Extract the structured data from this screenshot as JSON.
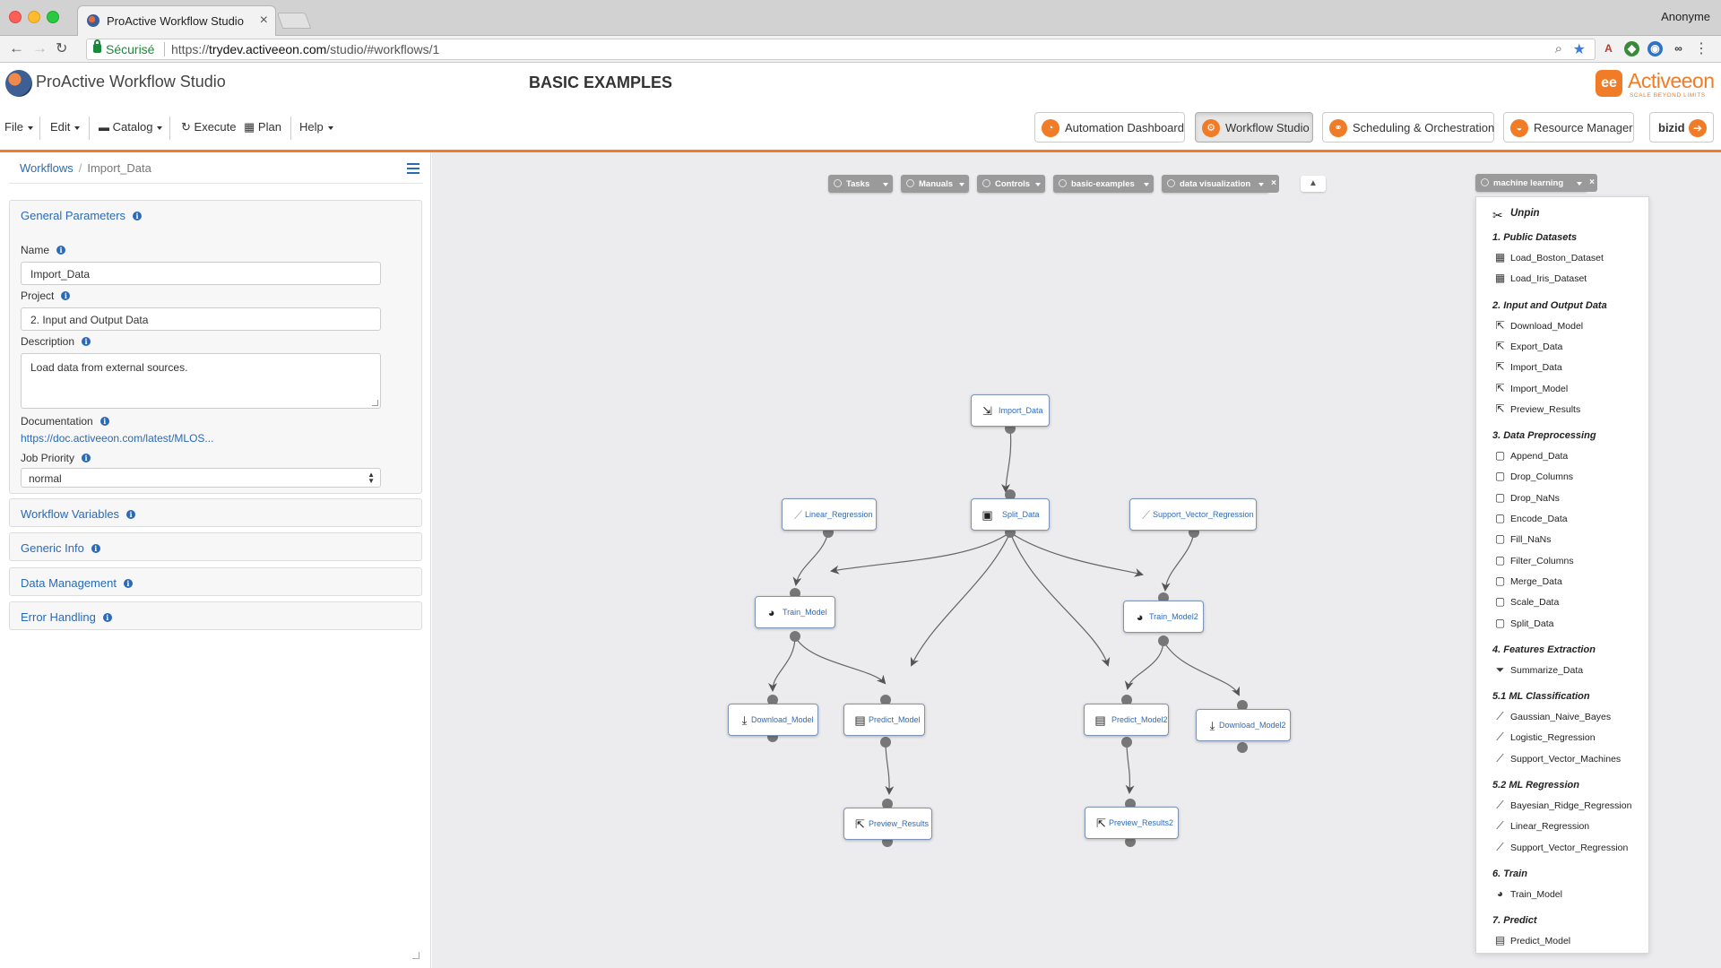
{
  "browser": {
    "tab_title": "ProActive Workflow Studio",
    "profile": "Anonyme",
    "secure_label": "Sécurisé",
    "url_scheme": "https://",
    "url_host": "trydev.activeeon.com",
    "url_path": "/studio/#workflows/1"
  },
  "app": {
    "title": "ProActive Workflow Studio",
    "page_heading": "BASIC EXAMPLES",
    "brand_name": "Activeeon",
    "brand_tagline": "SCALE BEYOND LIMITS",
    "menu": {
      "file": "File",
      "edit": "Edit",
      "catalog": "Catalog",
      "execute": "Execute",
      "plan": "Plan",
      "help": "Help"
    },
    "portals": [
      "Automation Dashboard",
      "Workflow Studio",
      "Scheduling & Orchestration",
      "Resource Manager"
    ],
    "user": "bizid"
  },
  "breadcrumb": {
    "root": "Workflows",
    "current": "Import_Data"
  },
  "general": {
    "title": "General Parameters",
    "name_label": "Name",
    "name_value": "Import_Data",
    "project_label": "Project",
    "project_value": "2. Input and Output Data",
    "description_label": "Description",
    "description_value": "Load data from external sources.",
    "documentation_label": "Documentation",
    "documentation_value": "https://doc.activeeon.com/latest/MLOS...",
    "priority_label": "Job Priority",
    "priority_value": "normal"
  },
  "panels": [
    "Workflow Variables",
    "Generic Info",
    "Data Management",
    "Error Handling"
  ],
  "toolbar": [
    "Tasks",
    "Manuals",
    "Controls",
    "basic-examples",
    "data visualization"
  ],
  "tasks": {
    "import_data": "Import_Data",
    "linear_regression": "Linear_Regression",
    "split_data": "Split_Data",
    "support_vector_regression": "Support_Vector_Regression",
    "train_model": "Train_Model",
    "train_model2": "Train_Model2",
    "download_model": "Download_Model",
    "predict_model": "Predict_Model",
    "predict_model2": "Predict_Model2",
    "download_model2": "Download_Model2",
    "preview_results": "Preview_Results",
    "preview_results2": "Preview_Results2"
  },
  "palette": {
    "title": "machine learning",
    "unpin": "Unpin",
    "sections": [
      {
        "title": "1. Public Datasets",
        "items": [
          "Load_Boston_Dataset",
          "Load_Iris_Dataset"
        ]
      },
      {
        "title": "2. Input and Output Data",
        "items": [
          "Download_Model",
          "Export_Data",
          "Import_Data",
          "Import_Model",
          "Preview_Results"
        ]
      },
      {
        "title": "3. Data Preprocessing",
        "items": [
          "Append_Data",
          "Drop_Columns",
          "Drop_NaNs",
          "Encode_Data",
          "Fill_NaNs",
          "Filter_Columns",
          "Merge_Data",
          "Scale_Data",
          "Split_Data"
        ]
      },
      {
        "title": "4. Features Extraction",
        "items": [
          "Summarize_Data"
        ]
      },
      {
        "title": "5.1 ML Classification",
        "items": [
          "Gaussian_Naive_Bayes",
          "Logistic_Regression",
          "Support_Vector_Machines"
        ]
      },
      {
        "title": "5.2 ML Regression",
        "items": [
          "Bayesian_Ridge_Regression",
          "Linear_Regression",
          "Support_Vector_Regression"
        ]
      },
      {
        "title": "6. Train",
        "items": [
          "Train_Model"
        ]
      },
      {
        "title": "7. Predict",
        "items": [
          "Predict_Model"
        ]
      }
    ]
  },
  "colors": {
    "accent": "#f07c28",
    "link": "#2a6ab6",
    "canvas": "#ececef"
  }
}
